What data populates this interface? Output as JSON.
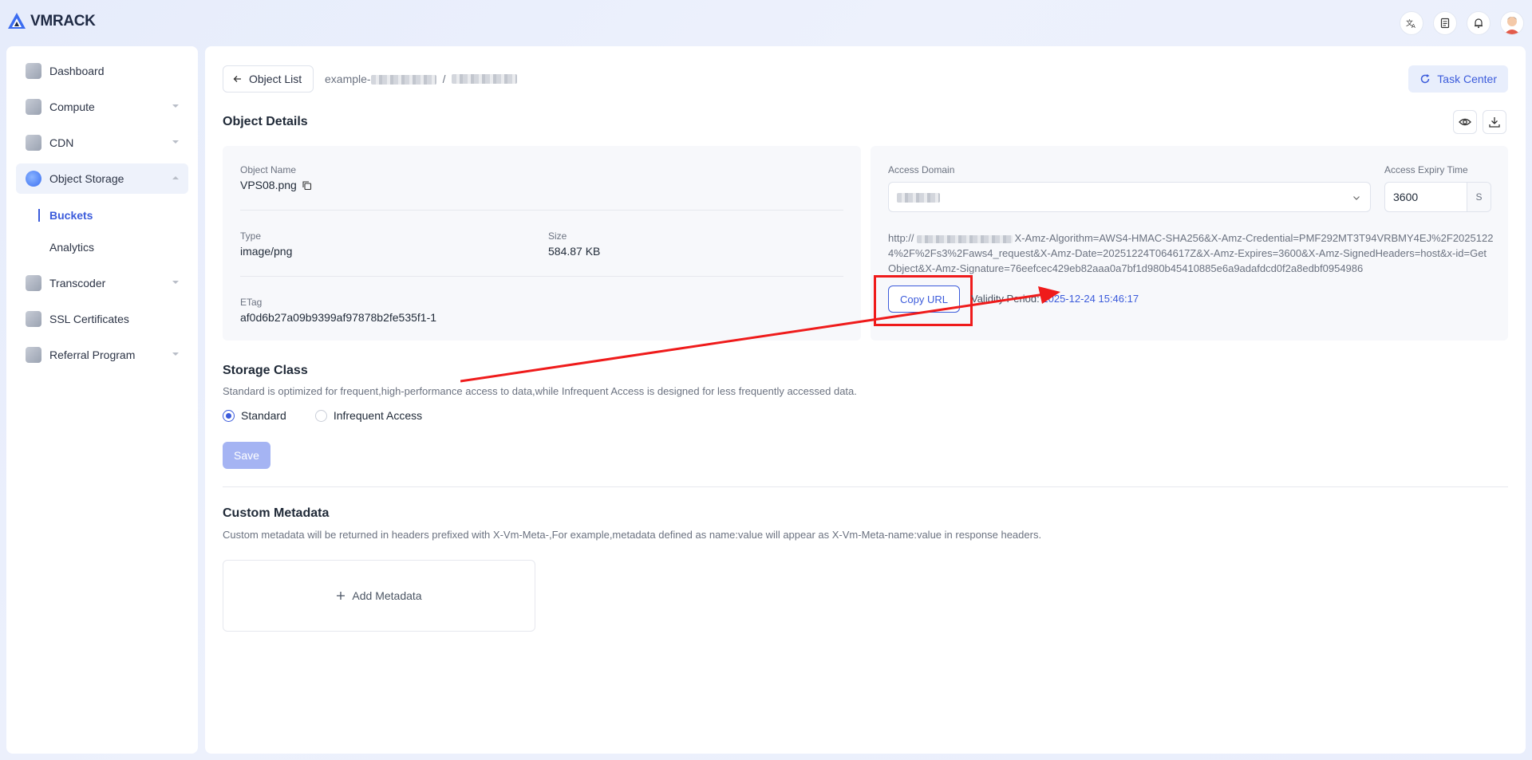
{
  "app": {
    "name": "VMRACK"
  },
  "sidebar": {
    "items": [
      {
        "label": "Dashboard",
        "icon": "dashboard-icon",
        "expandable": false
      },
      {
        "label": "Compute",
        "icon": "compute-icon",
        "expandable": true
      },
      {
        "label": "CDN",
        "icon": "cdn-icon",
        "expandable": true
      },
      {
        "label": "Object Storage",
        "icon": "object-storage-icon",
        "expandable": true,
        "active": true
      },
      {
        "label": "Transcoder",
        "icon": "transcoder-icon",
        "expandable": true
      },
      {
        "label": "SSL Certificates",
        "icon": "ssl-icon",
        "expandable": false
      },
      {
        "label": "Referral Program",
        "icon": "referral-icon",
        "expandable": true
      }
    ],
    "subitems": [
      {
        "label": "Buckets",
        "active": true
      },
      {
        "label": "Analytics",
        "active": false
      }
    ]
  },
  "header": {
    "back_label": "Object List",
    "breadcrumb_bucket": "example-",
    "breadcrumb_sep": "/",
    "task_center_label": "Task Center"
  },
  "details": {
    "title": "Object Details",
    "object_name_label": "Object Name",
    "object_name": "VPS08.png",
    "type_label": "Type",
    "type": "image/png",
    "size_label": "Size",
    "size": "584.87 KB",
    "etag_label": "ETag",
    "etag": "af0d6b27a09b9399af97878b2fe535f1-1"
  },
  "access": {
    "domain_label": "Access Domain",
    "expiry_label": "Access Expiry Time",
    "expiry_value": "3600",
    "expiry_unit": "S",
    "url_prefix": "http://",
    "url_rest": "X-Amz-Algorithm=AWS4-HMAC-SHA256&X-Amz-Credential=PMF292MT3T94VRBMY4EJ%2F20251224%2F%2Fs3%2Faws4_request&X-Amz-Date=20251224T064617Z&X-Amz-Expires=3600&X-Amz-SignedHeaders=host&x-id=GetObject&X-Amz-Signature=76eefcec429eb82aaa0a7bf1d980b45410885e6a9adafdcd0f2a8edbf0954986",
    "copy_label": "Copy URL",
    "validity_label": "Validity Period:",
    "validity_date": "2025-12-24 15:46:17"
  },
  "storage": {
    "title": "Storage Class",
    "description": "Standard is optimized for frequent,high-performance access to data,while Infrequent Access is designed for less frequently accessed data.",
    "options": [
      "Standard",
      "Infrequent Access"
    ],
    "selected": "Standard",
    "save_label": "Save"
  },
  "metadata": {
    "title": "Custom Metadata",
    "description": "Custom metadata will be returned in headers prefixed with X-Vm-Meta-,For example,metadata defined as name:value will appear as X-Vm-Meta-name:value in response headers.",
    "add_label": "Add Metadata"
  },
  "colors": {
    "accent": "#3b5bdb",
    "highlight": "#ef1b1b"
  }
}
